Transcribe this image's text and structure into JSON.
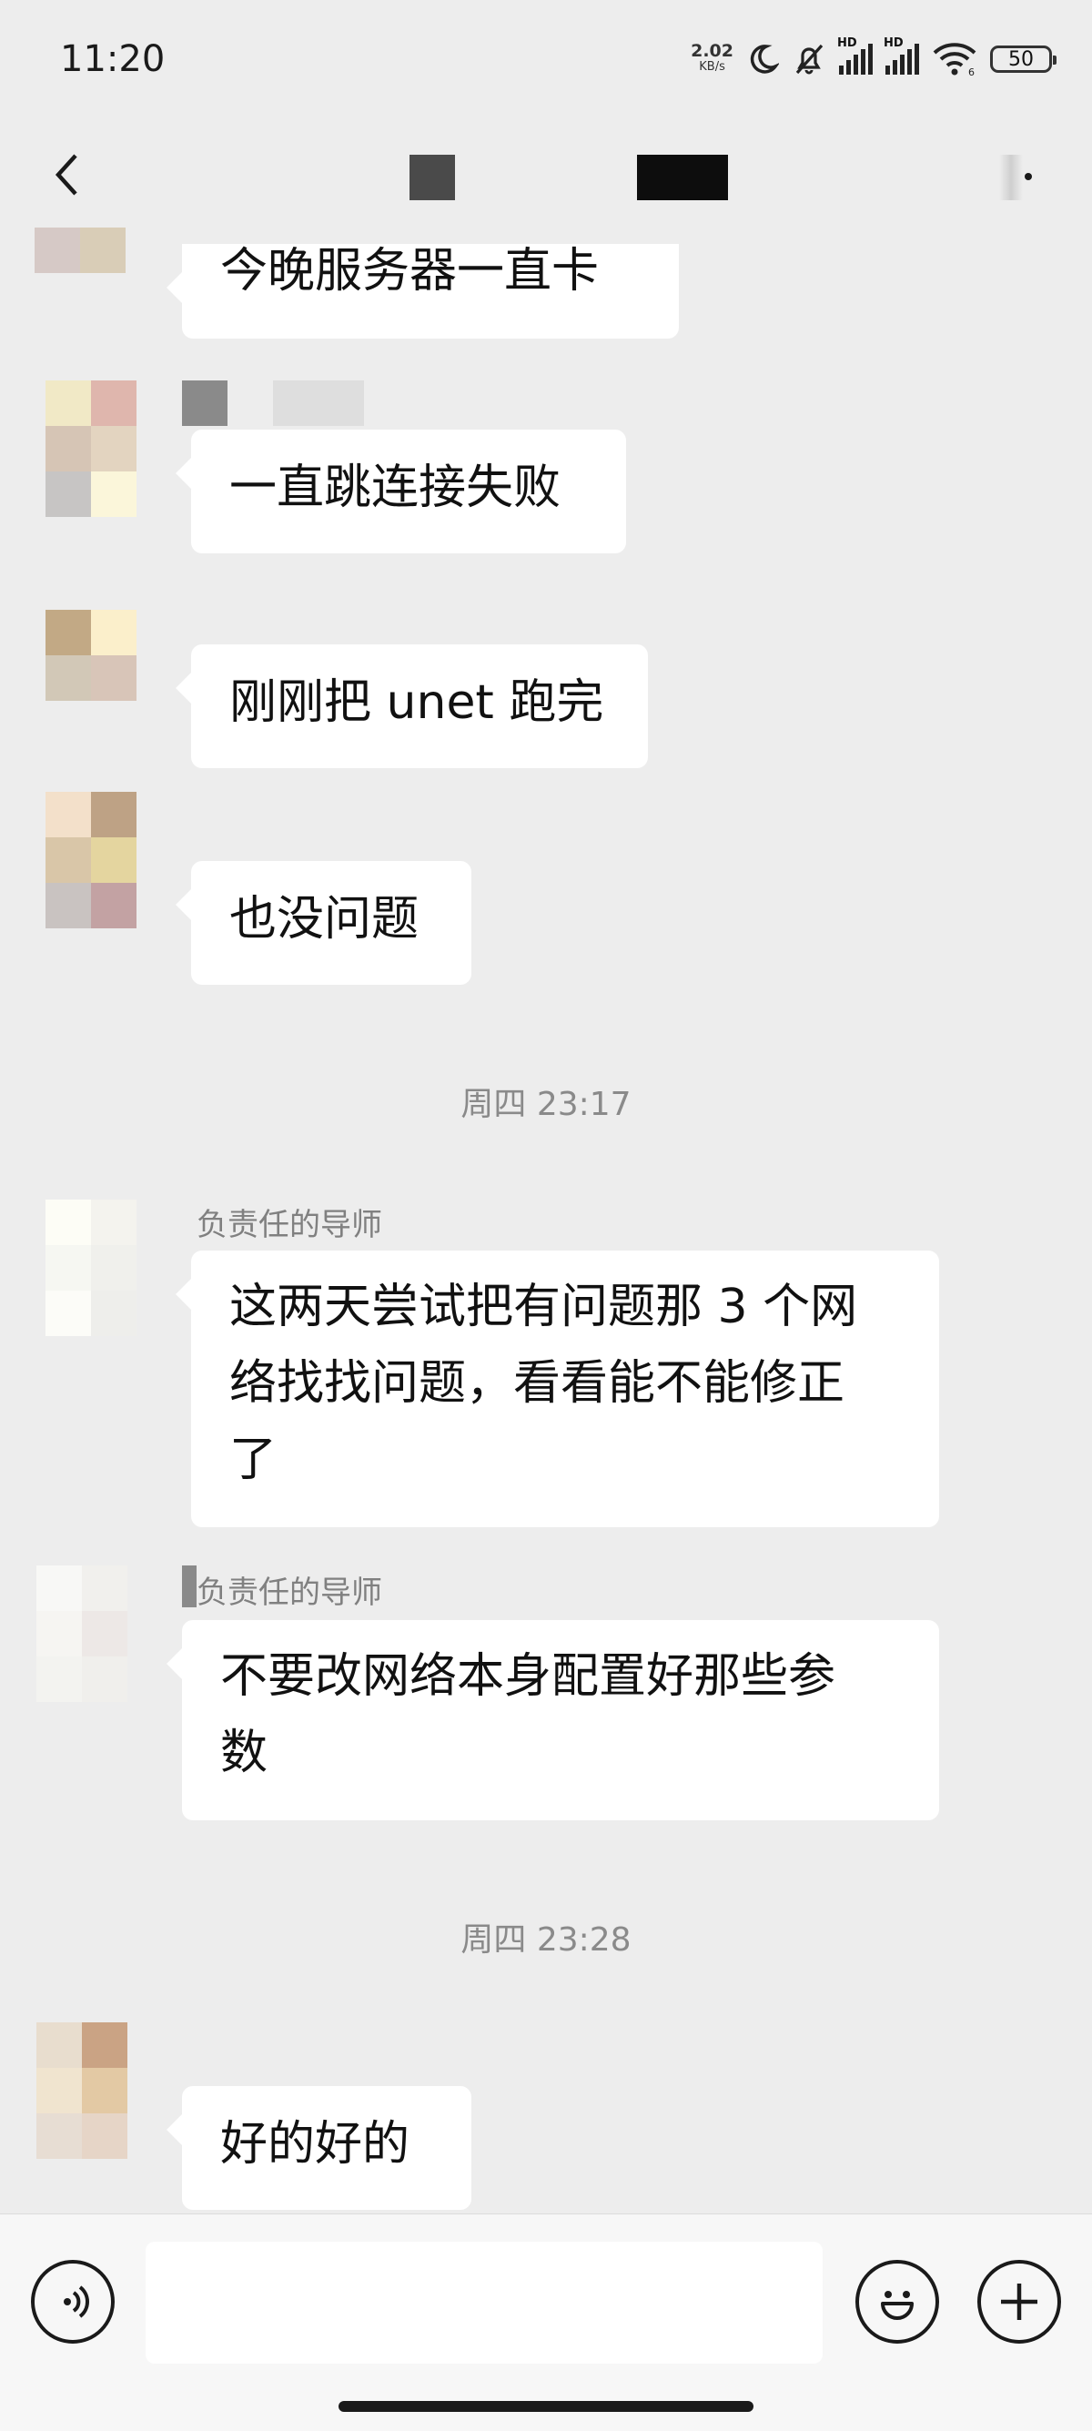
{
  "status_bar": {
    "time": "11:20",
    "net_speed_value": "2.02",
    "net_speed_unit": "KB/s",
    "hd_label_1": "HD",
    "hd_label_2": "HD",
    "wifi_sub": "6",
    "battery": "50",
    "icons": [
      "moon-icon",
      "mute-bell-icon",
      "signal-icon",
      "signal-icon",
      "wifi-icon",
      "battery-icon"
    ]
  },
  "nav": {
    "icons": [
      "back-arrow-icon",
      "more-dot-icon"
    ]
  },
  "messages": [
    {
      "type": "in",
      "text": "今晚服务器一直卡"
    },
    {
      "type": "in",
      "text": "一直跳连接失败"
    },
    {
      "type": "in",
      "text": "刚刚把 unet 跑完"
    },
    {
      "type": "in",
      "text": "也没问题"
    },
    {
      "type": "time",
      "text": "周四 23:17"
    },
    {
      "type": "in",
      "sender": "负责任的导师",
      "lines": [
        "这两天尝试把有问题那 3 个网",
        "络找找问题，看看能不能修正",
        "了"
      ]
    },
    {
      "type": "in",
      "sender": "负责任的导师",
      "lines": [
        "不要改网络本身配置好那些参",
        "数"
      ]
    },
    {
      "type": "time",
      "text": "周四 23:28"
    },
    {
      "type": "in",
      "text": "好的好的"
    }
  ],
  "input_bar": {
    "placeholder": "",
    "icons": [
      "voice-icon",
      "emoji-icon",
      "plus-icon"
    ]
  },
  "colors": {
    "background": "#ededed",
    "bubble": "#ffffff",
    "timestamp": "#8a8a8a"
  }
}
